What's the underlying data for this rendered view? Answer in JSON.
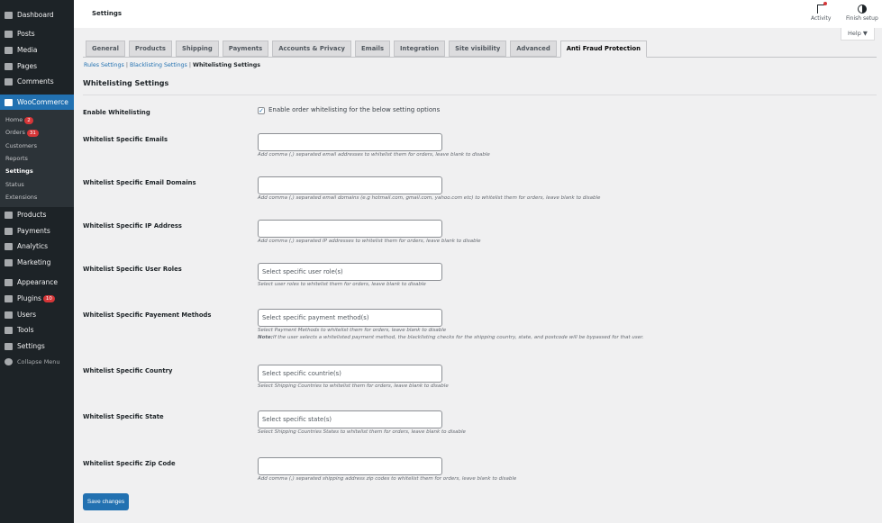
{
  "sidebar": {
    "items": [
      {
        "label": "Dashboard",
        "icon": "dashboard-icon"
      },
      {
        "label": "Posts",
        "icon": "pin-icon"
      },
      {
        "label": "Media",
        "icon": "media-icon"
      },
      {
        "label": "Pages",
        "icon": "pages-icon"
      },
      {
        "label": "Comments",
        "icon": "comment-icon"
      },
      {
        "label": "WooCommerce",
        "icon": "woo-icon"
      },
      {
        "label": "Products",
        "icon": "products-icon"
      },
      {
        "label": "Payments",
        "icon": "payments-icon"
      },
      {
        "label": "Analytics",
        "icon": "analytics-icon"
      },
      {
        "label": "Marketing",
        "icon": "megaphone-icon"
      },
      {
        "label": "Appearance",
        "icon": "brush-icon"
      },
      {
        "label": "Plugins",
        "icon": "plugin-icon",
        "badge": "10"
      },
      {
        "label": "Users",
        "icon": "users-icon"
      },
      {
        "label": "Tools",
        "icon": "wrench-icon"
      },
      {
        "label": "Settings",
        "icon": "settings-icon"
      },
      {
        "label": "Collapse Menu",
        "icon": "collapse-icon"
      }
    ],
    "submenu": [
      {
        "label": "Home",
        "badge": "2"
      },
      {
        "label": "Orders",
        "badge": "31"
      },
      {
        "label": "Customers"
      },
      {
        "label": "Reports"
      },
      {
        "label": "Settings"
      },
      {
        "label": "Status"
      },
      {
        "label": "Extensions"
      }
    ]
  },
  "header": {
    "title": "Settings",
    "activity": "Activity",
    "finish_setup": "Finish setup",
    "help": "Help ▼"
  },
  "tabs": [
    "General",
    "Products",
    "Shipping",
    "Payments",
    "Accounts & Privacy",
    "Emails",
    "Integration",
    "Site visibility",
    "Advanced",
    "Anti Fraud Protection"
  ],
  "sublinks": {
    "rules": "Rules Settings",
    "blacklisting": "Blacklisting Settings",
    "whitelisting": "Whitelisting Settings",
    "sep": "|"
  },
  "section_title": "Whitelisting Settings",
  "enable": {
    "label": "Enable Whitelisting",
    "checkbox_label": "Enable order whitelisting for the below setting options",
    "checked": true
  },
  "fields": [
    {
      "label": "Whitelist Specific Emails",
      "placeholder": "",
      "desc": "Add comma (,) separated email addresses to whitelist them for orders, leave blank to disable"
    },
    {
      "label": "Whitelist Specific Email Domains",
      "placeholder": "",
      "desc": "Add comma (,) separated email domains (e.g hotmail.com, gmail.com, yahoo.com etc) to whitelist them for orders, leave blank to disable"
    },
    {
      "label": "Whitelist Specific IP Address",
      "placeholder": "",
      "desc": "Add comma (,) separated IP addresses to whitelist them for orders, leave blank to disable"
    },
    {
      "label": "Whitelist Specific User Roles",
      "placeholder": "Select specific user role(s)",
      "desc": "Select user roles to whitelist them for orders, leave blank to disable"
    },
    {
      "label": "Whitelist Specific Payement Methods",
      "placeholder": "Select specific payment method(s)",
      "desc": "Select Payment Methods to whitelist them for orders, leave blank to disable",
      "note_label": "Note:",
      "note": "If the user selects a whitelisted payment method, the blacklisting checks for the shipping country, state, and postcode will be bypassed for that user."
    },
    {
      "label": "Whitelist Specific Country",
      "placeholder": "Select specific countrie(s)",
      "desc": "Select Shipping Countries to whitelist them for orders, leave blank to disable"
    },
    {
      "label": "Whitelist Specific State",
      "placeholder": "Select specific state(s)",
      "desc": "Select Shipping Countries States to whitelist them for orders, leave blank to disable"
    },
    {
      "label": "Whitelist Specific Zip Code",
      "placeholder": "",
      "desc": "Add comma (,) separated shipping address zip codes to whitelist them for orders, leave blank to disable"
    }
  ],
  "save_label": "Save changes"
}
